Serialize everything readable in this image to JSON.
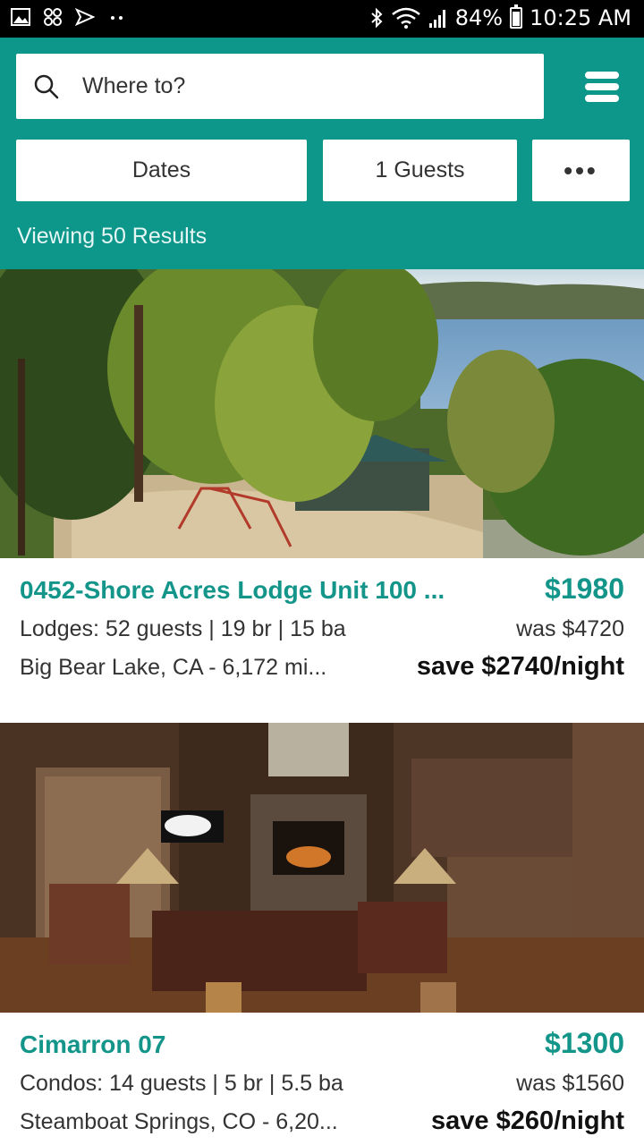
{
  "status_bar": {
    "battery": "84%",
    "time": "10:25 AM",
    "icons": [
      "gallery-icon",
      "pinwheel-icon",
      "send-icon",
      "more-dots-icon",
      "bluetooth-icon",
      "wifi-icon",
      "signal-icon",
      "battery-icon"
    ]
  },
  "search": {
    "placeholder": "Where to?",
    "icon": "search-icon"
  },
  "menu": {
    "icon": "hamburger-menu-icon"
  },
  "filters": {
    "dates": "Dates",
    "guests": "1 Guests",
    "more": "•••"
  },
  "results_text": "Viewing 50 Results",
  "colors": {
    "header": "#0d968a",
    "accent": "#13958a"
  },
  "listings": [
    {
      "title": "0452-Shore Acres Lodge Unit 100 ...",
      "price": "$1980",
      "details": "Lodges: 52 guests | 19 br | 15 ba",
      "was": "was $4720",
      "location": "Big Bear Lake, CA - 6,172 mi...",
      "save": "save $2740/night"
    },
    {
      "title": "Cimarron 07",
      "price": "$1300",
      "details": "Condos: 14 guests | 5 br | 5.5 ba",
      "was": "was $1560",
      "location": "Steamboat Springs, CO - 6,20...",
      "save": "save $260/night"
    }
  ]
}
